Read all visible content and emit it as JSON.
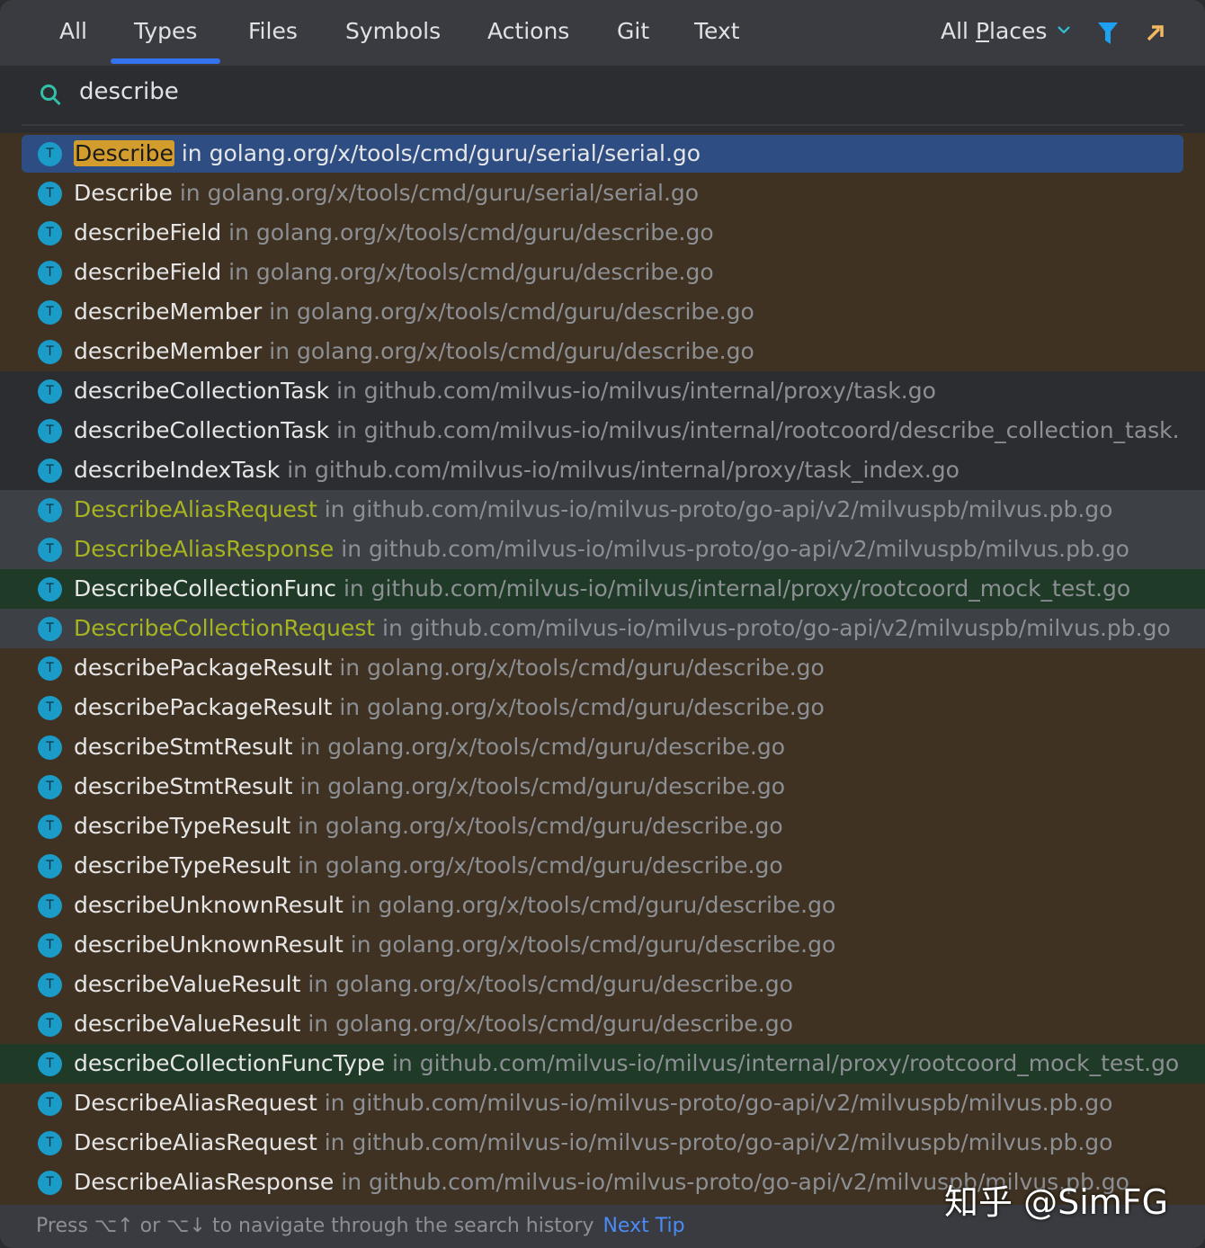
{
  "tabs": [
    {
      "label": "All"
    },
    {
      "label": "Types",
      "active": true
    },
    {
      "label": "Files"
    },
    {
      "label": "Symbols"
    },
    {
      "label": "Actions"
    },
    {
      "label": "Git"
    },
    {
      "label": "Text"
    }
  ],
  "scope": {
    "label_a": "All ",
    "label_u": "P",
    "label_b": "laces",
    "icon": "chevron-down-icon"
  },
  "toolbar": {
    "filter_icon": "filter-icon",
    "open_icon": "open-in-window-icon"
  },
  "search": {
    "value": "describe",
    "icon": "search-icon"
  },
  "colors": {
    "accent": "#3574f0",
    "selected": "#2e4d83",
    "highlight": "#d39d2e",
    "brown": "#3f3222",
    "gray": "#3d4045",
    "green": "#1f3a26",
    "link": "#4b8bf5"
  },
  "results": [
    {
      "name": "Describe",
      "loc": "in golang.org/x/tools/cmd/guru/serial/serial.go",
      "bg": "selected",
      "match": "Describe"
    },
    {
      "name": "Describe",
      "loc": "in golang.org/x/tools/cmd/guru/serial/serial.go",
      "bg": "brown"
    },
    {
      "name": "describeField",
      "loc": "in golang.org/x/tools/cmd/guru/describe.go",
      "bg": "brown"
    },
    {
      "name": "describeField",
      "loc": "in golang.org/x/tools/cmd/guru/describe.go",
      "bg": "brown"
    },
    {
      "name": "describeMember",
      "loc": "in golang.org/x/tools/cmd/guru/describe.go",
      "bg": "brown"
    },
    {
      "name": "describeMember",
      "loc": "in golang.org/x/tools/cmd/guru/describe.go",
      "bg": "brown"
    },
    {
      "name": "describeCollectionTask",
      "loc": "in github.com/milvus-io/milvus/internal/proxy/task.go",
      "bg": "dark"
    },
    {
      "name": "describeCollectionTask",
      "loc": "in github.com/milvus-io/milvus/internal/rootcoord/describe_collection_task.",
      "bg": "dark"
    },
    {
      "name": "describeIndexTask",
      "loc": "in github.com/milvus-io/milvus/internal/proxy/task_index.go",
      "bg": "dark"
    },
    {
      "name": "DescribeAliasRequest",
      "loc": "in github.com/milvus-io/milvus-proto/go-api/v2/milvuspb/milvus.pb.go",
      "bg": "gray"
    },
    {
      "name": "DescribeAliasResponse",
      "loc": "in github.com/milvus-io/milvus-proto/go-api/v2/milvuspb/milvus.pb.go",
      "bg": "gray"
    },
    {
      "name": "DescribeCollectionFunc",
      "loc": "in github.com/milvus-io/milvus/internal/proxy/rootcoord_mock_test.go",
      "bg": "green"
    },
    {
      "name": "DescribeCollectionRequest",
      "loc": "in github.com/milvus-io/milvus-proto/go-api/v2/milvuspb/milvus.pb.go",
      "bg": "gray"
    },
    {
      "name": "describePackageResult",
      "loc": "in golang.org/x/tools/cmd/guru/describe.go",
      "bg": "brown"
    },
    {
      "name": "describePackageResult",
      "loc": "in golang.org/x/tools/cmd/guru/describe.go",
      "bg": "brown"
    },
    {
      "name": "describeStmtResult",
      "loc": "in golang.org/x/tools/cmd/guru/describe.go",
      "bg": "brown"
    },
    {
      "name": "describeStmtResult",
      "loc": "in golang.org/x/tools/cmd/guru/describe.go",
      "bg": "brown"
    },
    {
      "name": "describeTypeResult",
      "loc": "in golang.org/x/tools/cmd/guru/describe.go",
      "bg": "brown"
    },
    {
      "name": "describeTypeResult",
      "loc": "in golang.org/x/tools/cmd/guru/describe.go",
      "bg": "brown"
    },
    {
      "name": "describeUnknownResult",
      "loc": "in golang.org/x/tools/cmd/guru/describe.go",
      "bg": "brown"
    },
    {
      "name": "describeUnknownResult",
      "loc": "in golang.org/x/tools/cmd/guru/describe.go",
      "bg": "brown"
    },
    {
      "name": "describeValueResult",
      "loc": "in golang.org/x/tools/cmd/guru/describe.go",
      "bg": "brown"
    },
    {
      "name": "describeValueResult",
      "loc": "in golang.org/x/tools/cmd/guru/describe.go",
      "bg": "brown"
    },
    {
      "name": "describeCollectionFuncType",
      "loc": "in github.com/milvus-io/milvus/internal/proxy/rootcoord_mock_test.go",
      "bg": "green"
    },
    {
      "name": "DescribeAliasRequest",
      "loc": "in github.com/milvus-io/milvus-proto/go-api/v2/milvuspb/milvus.pb.go",
      "bg": "brown"
    },
    {
      "name": "DescribeAliasRequest",
      "loc": "in github.com/milvus-io/milvus-proto/go-api/v2/milvuspb/milvus.pb.go",
      "bg": "brown"
    },
    {
      "name": "DescribeAliasResponse",
      "loc": "in github.com/milvus-io/milvus-proto/go-api/v2/milvuspb/milvus.pb.go",
      "bg": "brown"
    }
  ],
  "type_badge": "T",
  "footer": {
    "hint": "Press ⌥↑ or ⌥↓ to navigate through the search history",
    "next_tip": "Next Tip"
  },
  "watermark": "知乎 @SimFG"
}
